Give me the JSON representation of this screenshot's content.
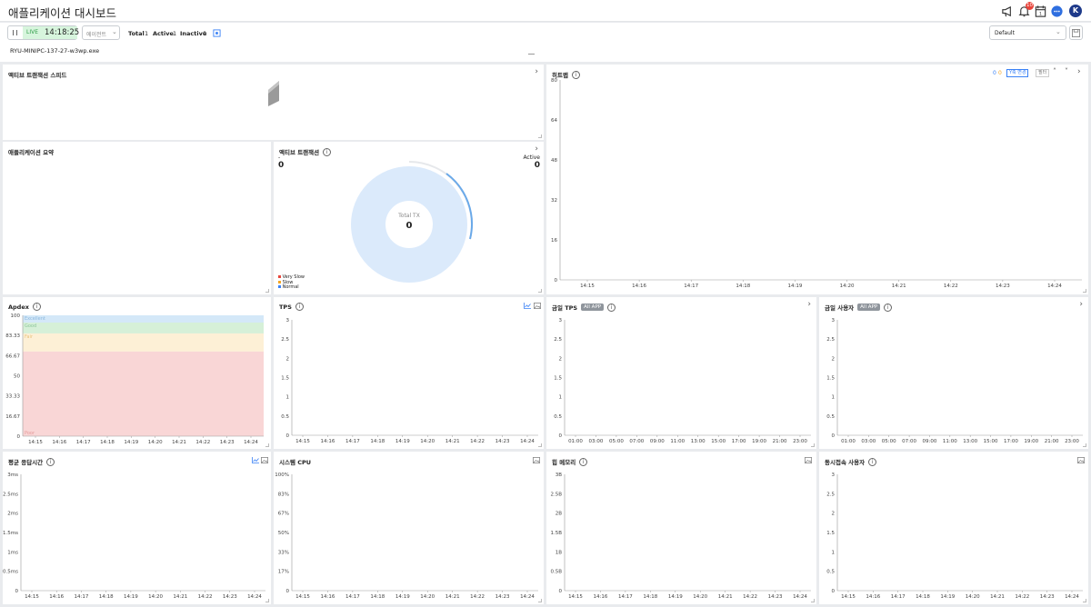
{
  "header": {
    "title": "애플리케이션 대시보드",
    "notification_count": "10",
    "avatar_letter": "K"
  },
  "toolbar": {
    "live_label": "LIVE",
    "time": "14:18:25",
    "agent_placeholder": "에이전트",
    "total_label": "Total",
    "total_value": "1",
    "active_label": "Active",
    "active_value": "1",
    "inactive_label": "Inactive",
    "inactive_value": "0",
    "agent_name": "RYU-MINIPC-137-27-w3wp.exe",
    "preset_value": "Default"
  },
  "panels": {
    "active_speed": {
      "title": "액티브 트랜잭션 스피드"
    },
    "heatmap": {
      "title": "히트맵",
      "legend_a": "0",
      "legend_b": "0",
      "btn_ychange": "Y축 변경",
      "btn_filter": "필터",
      "y_ticks": [
        "80",
        "64",
        "48",
        "32",
        "16",
        "0"
      ],
      "x_ticks": [
        "14:15",
        "14:16",
        "14:17",
        "14:18",
        "14:19",
        "14:20",
        "14:21",
        "14:22",
        "14:23",
        "14:24"
      ]
    },
    "app_summary": {
      "title": "애플리케이션 요약"
    },
    "active_tx": {
      "title": "액티브 트랜잭션",
      "left_label": "-",
      "left_value": "0",
      "right_label": "Active",
      "right_value": "0",
      "center_label": "Total TX",
      "center_value": "0",
      "legend": [
        "Very Slow",
        "Slow",
        "Normal"
      ]
    },
    "apdex": {
      "title": "Apdex",
      "y_ticks": [
        "100",
        "83.33",
        "66.67",
        "50",
        "33.33",
        "16.67",
        "0"
      ],
      "bands": [
        "Excellent",
        "Good",
        "Fair",
        "Poor"
      ],
      "x_ticks": [
        "14:15",
        "14:16",
        "14:17",
        "14:18",
        "14:19",
        "14:20",
        "14:21",
        "14:22",
        "14:23",
        "14:24"
      ]
    },
    "tps": {
      "title": "TPS",
      "y_ticks": [
        "3",
        "2.5",
        "2",
        "1.5",
        "1",
        "0.5",
        "0"
      ],
      "x_ticks": [
        "14:15",
        "14:16",
        "14:17",
        "14:18",
        "14:19",
        "14:20",
        "14:21",
        "14:22",
        "14:23",
        "14:24"
      ]
    },
    "today_tps": {
      "title": "금일 TPS",
      "tag": "All APP",
      "y_ticks": [
        "3",
        "2.5",
        "2",
        "1.5",
        "1",
        "0.5",
        "0"
      ],
      "x_ticks": [
        "01:00",
        "03:00",
        "05:00",
        "07:00",
        "09:00",
        "11:00",
        "13:00",
        "15:00",
        "17:00",
        "19:00",
        "21:00",
        "23:00"
      ]
    },
    "today_users": {
      "title": "금일 사용자",
      "tag": "All APP",
      "y_ticks": [
        "3",
        "2.5",
        "2",
        "1.5",
        "1",
        "0.5",
        "0"
      ],
      "x_ticks": [
        "01:00",
        "03:00",
        "05:00",
        "07:00",
        "09:00",
        "11:00",
        "13:00",
        "15:00",
        "17:00",
        "19:00",
        "21:00",
        "23:00"
      ]
    },
    "resp_time": {
      "title": "평균 응답시간",
      "y_ticks": [
        "3ms",
        "2.5ms",
        "2ms",
        "1.5ms",
        "1ms",
        "0.5ms",
        "0"
      ],
      "x_ticks": [
        "14:15",
        "14:16",
        "14:17",
        "14:18",
        "14:19",
        "14:20",
        "14:21",
        "14:22",
        "14:23",
        "14:24"
      ]
    },
    "sys_cpu": {
      "title": "시스템 CPU",
      "y_ticks": [
        "100%",
        "83%",
        "67%",
        "50%",
        "33%",
        "17%",
        "0"
      ],
      "x_ticks": [
        "14:15",
        "14:16",
        "14:17",
        "14:18",
        "14:19",
        "14:20",
        "14:21",
        "14:22",
        "14:23",
        "14:24"
      ]
    },
    "heap": {
      "title": "힙 메모리",
      "y_ticks": [
        "3B",
        "2.5B",
        "2B",
        "1.5B",
        "1B",
        "0.5B",
        "0"
      ],
      "x_ticks": [
        "14:15",
        "14:16",
        "14:17",
        "14:18",
        "14:19",
        "14:20",
        "14:21",
        "14:22",
        "14:23",
        "14:24"
      ]
    },
    "concurrent_users": {
      "title": "동시접속 사용자",
      "y_ticks": [
        "3",
        "2.5",
        "2",
        "1.5",
        "1",
        "0.5",
        "0"
      ],
      "x_ticks": [
        "14:15",
        "14:16",
        "14:17",
        "14:18",
        "14:19",
        "14:20",
        "14:21",
        "14:22",
        "14:23",
        "14:24"
      ]
    }
  },
  "colors": {
    "accent": "#3b82f6",
    "live_bg": "#d7f5dd",
    "donut": "#dbeafb",
    "excellent": "#d4e8f8",
    "good": "#d6f0d8",
    "fair": "#fdf0d6",
    "poor": "#f9d6d6",
    "very_slow": "#e8453c",
    "slow": "#f5a623",
    "normal": "#3b82f6"
  }
}
